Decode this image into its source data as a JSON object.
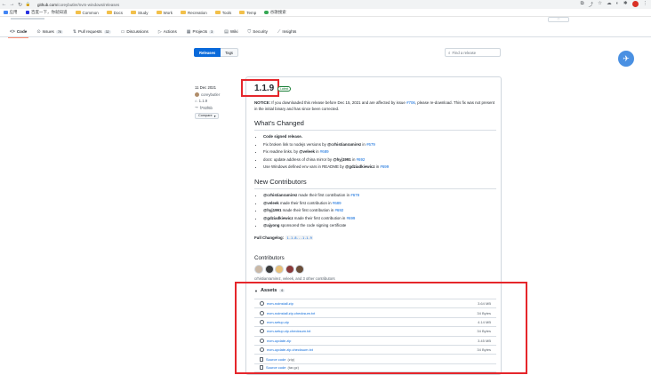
{
  "browser": {
    "url_host": "github.com",
    "url_path": "/coreybutler/nvm-windows/releases",
    "bookmarks": [
      {
        "label": "应用",
        "kind": "grid"
      },
      {
        "label": "百度一下，你就知道",
        "kind": "baidu"
      },
      {
        "label": "Common",
        "kind": "folder"
      },
      {
        "label": "Docs",
        "kind": "folder"
      },
      {
        "label": "Study",
        "kind": "folder"
      },
      {
        "label": "Work",
        "kind": "folder"
      },
      {
        "label": "Recreation",
        "kind": "folder"
      },
      {
        "label": "Tools",
        "kind": "folder"
      },
      {
        "label": "Temp",
        "kind": "folder"
      },
      {
        "label": "谷歌搜索",
        "kind": "google"
      }
    ]
  },
  "repo_tabs": [
    {
      "label": "Code",
      "icon": "code-icon",
      "count": "",
      "active": true
    },
    {
      "label": "Issues",
      "icon": "issue-icon",
      "count": "78",
      "active": false
    },
    {
      "label": "Pull requests",
      "icon": "pull-request-icon",
      "count": "32",
      "active": false
    },
    {
      "label": "Discussions",
      "icon": "discussions-icon",
      "count": "",
      "active": false
    },
    {
      "label": "Actions",
      "icon": "actions-icon",
      "count": "",
      "active": false
    },
    {
      "label": "Projects",
      "icon": "projects-icon",
      "count": "3",
      "active": false
    },
    {
      "label": "Wiki",
      "icon": "wiki-icon",
      "count": "",
      "active": false
    },
    {
      "label": "Security",
      "icon": "security-icon",
      "count": "",
      "active": false
    },
    {
      "label": "Insights",
      "icon": "insights-icon",
      "count": "",
      "active": false
    }
  ],
  "toolbar": {
    "releases_label": "Releases",
    "tags_label": "Tags",
    "find_placeholder": "Find a release"
  },
  "release": {
    "date": "11 Dec 2021",
    "author": "coreybutler",
    "tag": "1.1.9",
    "commit": "f792f6b",
    "compare_label": "Compare",
    "title": "1.1.9",
    "latest_label": "Latest",
    "notice_label": "NOTICE:",
    "notice_text_1": "If you downloaded this release before Dec 15, 2021 and are affected by issue",
    "notice_issue": "#706",
    "notice_text_2": ", please re-download. This fix was not present in the initial binary and has since been corrected.",
    "whats_changed_heading": "What's Changed",
    "changes": [
      {
        "pre": "",
        "bold": "Code signed release.",
        "mid": "",
        "user": "",
        "link": ""
      },
      {
        "pre": "Fix broken link to nodejs versions by ",
        "bold": "",
        "mid": " in ",
        "user": "@crhistianramirez",
        "link": "#679"
      },
      {
        "pre": "Fix readme links. by ",
        "bold": "",
        "mid": " in ",
        "user": "@veleek",
        "link": "#689"
      },
      {
        "pre": "docs: update address of china mirror by ",
        "bold": "",
        "mid": " in ",
        "user": "@hyj1991",
        "link": "#692"
      },
      {
        "pre": "Use Windows defined env vars in README by ",
        "bold": "",
        "mid": " in ",
        "user": "@gdziadkiewicz",
        "link": "#699"
      }
    ],
    "new_contributors_heading": "New Contributors",
    "new_contributors": [
      {
        "user": "@crhistianramirez",
        "text": " made their first contribution in ",
        "link": "#679"
      },
      {
        "user": "@veleek",
        "text": " made their first contribution in ",
        "link": "#689"
      },
      {
        "user": "@hyj1991",
        "text": " made their first contribution in ",
        "link": "#692"
      },
      {
        "user": "@gdziadkiewicz",
        "text": " made their first contribution in ",
        "link": "#699"
      },
      {
        "user": "@ajyong",
        "text": " sponsored the code signing certificate",
        "link": ""
      }
    ],
    "full_changelog_label": "Full Changelog:",
    "full_changelog_value": "1.1.8...1.1.9",
    "contributors_heading": "Contributors",
    "contributors_text": "crhistianramirez, veleek, and 3 other contributors",
    "avatar_colors": [
      "#c9b8a6",
      "#3d3d3d",
      "#e8c07a",
      "#8b3a3a",
      "#6b4f3a"
    ],
    "assets_label": "Assets",
    "assets_count": "6",
    "assets": [
      {
        "name": "nvm-noinstall.zip",
        "sub": "",
        "size": "3.64 MB",
        "icon": "package-icon"
      },
      {
        "name": "nvm-noinstall.zip.checksum.txt",
        "sub": "",
        "size": "34 Bytes",
        "icon": "package-icon"
      },
      {
        "name": "nvm-setup.zip",
        "sub": "",
        "size": "4.14 MB",
        "icon": "package-icon"
      },
      {
        "name": "nvm-setup.zip.checksum.txt",
        "sub": "",
        "size": "34 Bytes",
        "icon": "package-icon"
      },
      {
        "name": "nvm-update.zip",
        "sub": "",
        "size": "3.45 MB",
        "icon": "package-icon"
      },
      {
        "name": "nvm-update.zip.checksum.txt",
        "sub": "",
        "size": "34 Bytes",
        "icon": "package-icon"
      },
      {
        "name": "Source code",
        "sub": "(zip)",
        "size": "",
        "icon": "file-zip-icon"
      },
      {
        "name": "Source code",
        "sub": "(tar.gz)",
        "size": "",
        "icon": "file-zip-icon"
      }
    ]
  },
  "colors": {
    "accent": "#0969da",
    "highlight_box": "#e5262b",
    "latest_green": "#1a7f37"
  }
}
